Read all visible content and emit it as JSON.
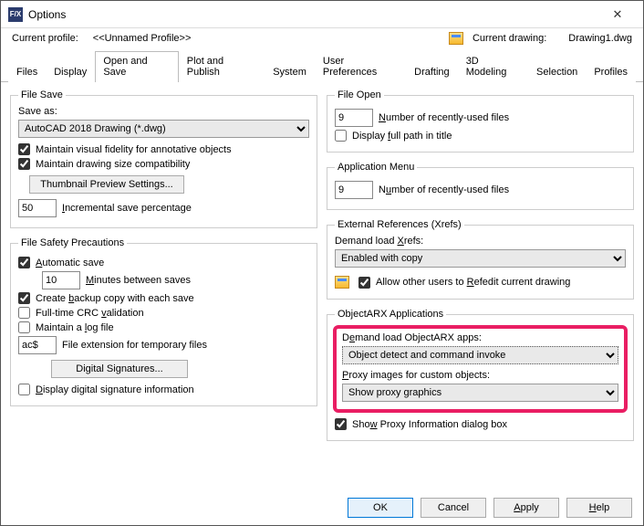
{
  "window": {
    "title": "Options"
  },
  "profile": {
    "label": "Current profile:",
    "name": "<<Unnamed Profile>>",
    "drawing_label": "Current drawing:",
    "drawing_name": "Drawing1.dwg"
  },
  "tabs": [
    "Files",
    "Display",
    "Open and Save",
    "Plot and Publish",
    "System",
    "User Preferences",
    "Drafting",
    "3D Modeling",
    "Selection",
    "Profiles"
  ],
  "active_tab": "Open and Save",
  "buttons": {
    "ok": "OK",
    "cancel": "Cancel",
    "apply": "Apply",
    "help": "Help"
  },
  "left": {
    "file_save": {
      "legend": "File Save",
      "save_as_label": "Save as:",
      "save_as_value": "AutoCAD 2018 Drawing (*.dwg)",
      "maintain_visual": "Maintain visual fidelity for annotative objects",
      "maintain_visual_checked": true,
      "maintain_size": "Maintain drawing size compatibility",
      "maintain_size_checked": true,
      "thumb_btn": "Thumbnail Preview Settings...",
      "incremental_value": "50",
      "incremental_label": "Incremental save percentage"
    },
    "safety": {
      "legend": "File Safety Precautions",
      "auto_save": "Automatic save",
      "auto_save_checked": true,
      "minutes_value": "10",
      "minutes_label": "Minutes between saves",
      "backup": "Create backup copy with each save",
      "backup_checked": true,
      "crc": "Full-time CRC validation",
      "crc_checked": false,
      "log": "Maintain a log file",
      "log_checked": false,
      "ext_value": "ac$",
      "ext_label": "File extension for temporary files",
      "digsig_btn": "Digital Signatures...",
      "display_digsig": "Display digital signature information",
      "display_digsig_checked": false
    }
  },
  "right": {
    "file_open": {
      "legend": "File Open",
      "recent_value": "9",
      "recent_label": "Number of recently-used files",
      "display_full": "Display full path in title",
      "display_full_checked": false
    },
    "app_menu": {
      "legend": "Application Menu",
      "recent_value": "9",
      "recent_label": "Number of recently-used files"
    },
    "xrefs": {
      "legend": "External References (Xrefs)",
      "demand_label": "Demand load Xrefs:",
      "demand_value": "Enabled with copy",
      "allow_refedit": "Allow other users to Refedit current drawing",
      "allow_refedit_checked": true
    },
    "arx": {
      "legend": "ObjectARX Applications",
      "demand_label": "Demand load ObjectARX apps:",
      "demand_value": "Object detect and command invoke",
      "proxy_label": "Proxy images for custom objects:",
      "proxy_value": "Show proxy graphics",
      "show_proxy_info": "Show Proxy Information dialog box",
      "show_proxy_info_checked": true
    }
  }
}
